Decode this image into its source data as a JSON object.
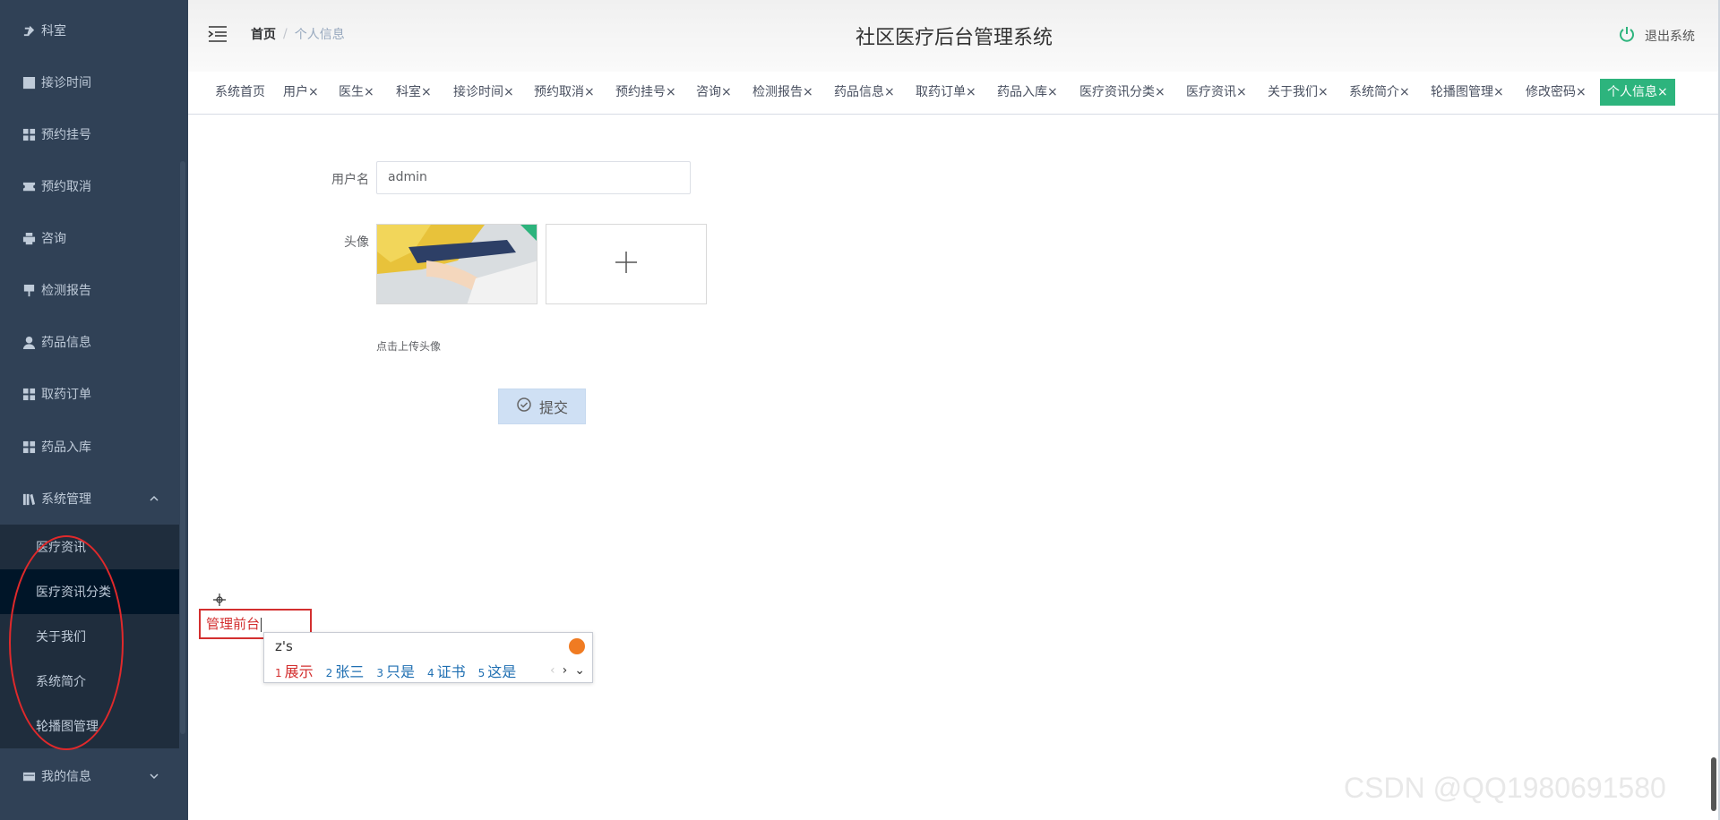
{
  "sidebar": {
    "items": [
      {
        "label": "科室",
        "icon": "edit-icon"
      },
      {
        "label": "接诊时间",
        "icon": "chart-icon"
      },
      {
        "label": "预约挂号",
        "icon": "grid-icon"
      },
      {
        "label": "预约取消",
        "icon": "ticket-icon"
      },
      {
        "label": "咨询",
        "icon": "printer-icon"
      },
      {
        "label": "检测报告",
        "icon": "report-icon"
      },
      {
        "label": "药品信息",
        "icon": "user-icon"
      },
      {
        "label": "取药订单",
        "icon": "grid-icon"
      },
      {
        "label": "药品入库",
        "icon": "grid-icon"
      },
      {
        "label": "系统管理",
        "icon": "library-icon"
      },
      {
        "label": "我的信息",
        "icon": "card-icon"
      }
    ],
    "submenu": [
      "医疗资讯",
      "医疗资讯分类",
      "关于我们",
      "系统简介",
      "轮播图管理"
    ]
  },
  "header": {
    "breadcrumb_home": "首页",
    "breadcrumb_sep": "/",
    "breadcrumb_current": "个人信息",
    "title": "社区医疗后台管理系统",
    "logout": "退出系统"
  },
  "tags": [
    "系统首页",
    "用户×",
    "医生×",
    "科室×",
    "接诊时间×",
    "预约取消×",
    "预约挂号×",
    "咨询×",
    "检测报告×",
    "药品信息×",
    "取药订单×",
    "药品入库×",
    "医疗资讯分类×",
    "医疗资讯×",
    "关于我们×",
    "系统简介×",
    "轮播图管理×",
    "修改密码×",
    "个人信息×"
  ],
  "form": {
    "username_label": "用户名",
    "username_value": "admin",
    "avatar_label": "头像",
    "upload_hint": "点击上传头像",
    "submit": "提交"
  },
  "ime": {
    "typed": "管理前台",
    "composition": "z's",
    "candidates": [
      {
        "n": "1",
        "text": "展示"
      },
      {
        "n": "2",
        "text": "张三"
      },
      {
        "n": "3",
        "text": "只是"
      },
      {
        "n": "4",
        "text": "证书"
      },
      {
        "n": "5",
        "text": "这是"
      }
    ],
    "prev": "‹",
    "next": "›",
    "expand": "⌄"
  },
  "watermark": "CSDN @QQ1980691580",
  "colors": {
    "sidebar_bg": "#304156",
    "accent": "#2db47d",
    "annotation_red": "#e0292b"
  }
}
